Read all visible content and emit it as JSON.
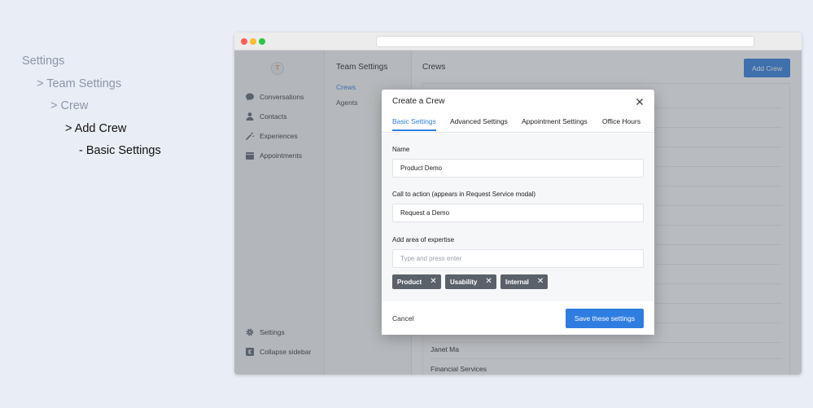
{
  "breadcrumbs": [
    {
      "text": "Settings",
      "active": false
    },
    {
      "text": "> Team Settings",
      "active": false
    },
    {
      "text": "> Crew",
      "active": false
    },
    {
      "text": "> Add Crew",
      "active": true
    },
    {
      "text": "-  Basic Settings",
      "active": true
    }
  ],
  "app": {
    "logo_text": "T",
    "sidebar": {
      "items": [
        {
          "label": "Conversations",
          "icon": "chat-bubble-icon"
        },
        {
          "label": "Contacts",
          "icon": "person-icon"
        },
        {
          "label": "Experiences",
          "icon": "magic-wand-icon"
        },
        {
          "label": "Appointments",
          "icon": "calendar-icon"
        }
      ],
      "settings_label": "Settings",
      "collapse_label": "Collapse sidebar"
    },
    "subnav": {
      "title": "Team Settings",
      "items": [
        {
          "label": "Crews",
          "active": true
        },
        {
          "label": "Agents",
          "active": false
        }
      ]
    },
    "main": {
      "title": "Crews",
      "add_button": "Add Crew",
      "visible_rows": [
        "Janet Ma",
        "Financial Services"
      ]
    }
  },
  "modal": {
    "title": "Create a Crew",
    "tabs": [
      "Basic Settings",
      "Advanced Settings",
      "Appointment Settings",
      "Office Hours"
    ],
    "active_tab": "Basic Settings",
    "fields": {
      "name": {
        "label": "Name",
        "value": "Product Demo"
      },
      "cta": {
        "label": "Call to action (appears in Request Service modal)",
        "value": "Request a Demo"
      },
      "expertise": {
        "label": "Add area of expertise",
        "placeholder": "Type and press enter"
      }
    },
    "tags": [
      "Product",
      "Usability",
      "Internal"
    ],
    "cancel_label": "Cancel",
    "save_label": "Save these settings"
  },
  "colors": {
    "accent": "#2f7de1",
    "tag_bg": "#5b616b",
    "page_bg": "#e9edf5"
  }
}
